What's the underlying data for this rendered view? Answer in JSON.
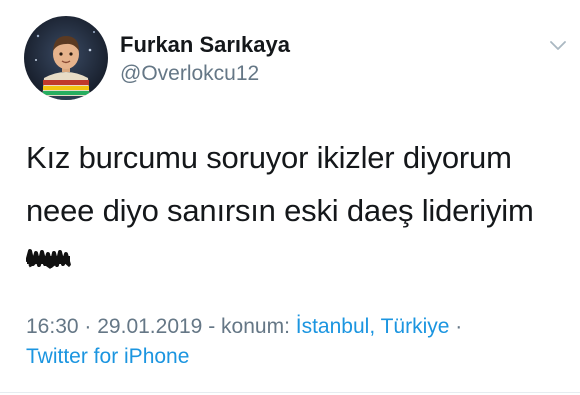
{
  "user": {
    "display_name": "Furkan Sarıkaya",
    "handle": "@Overlokcu12"
  },
  "tweet": {
    "lines": [
      "Kız burcumu soruyor ikizler diyorum",
      "neee diyo sanırsın eski daeş lideriyim"
    ]
  },
  "meta": {
    "time": "16:30",
    "separator": "·",
    "date": "29.01.2019",
    "dash": "-",
    "location_label": "konum:",
    "location": "İstanbul, Türkiye",
    "source": "Twitter for iPhone"
  },
  "icons": {
    "menu": "chevron-down-icon"
  },
  "colors": {
    "text": "#14171a",
    "muted": "#657786",
    "link": "#1b95e0",
    "background": "#ffffff"
  }
}
